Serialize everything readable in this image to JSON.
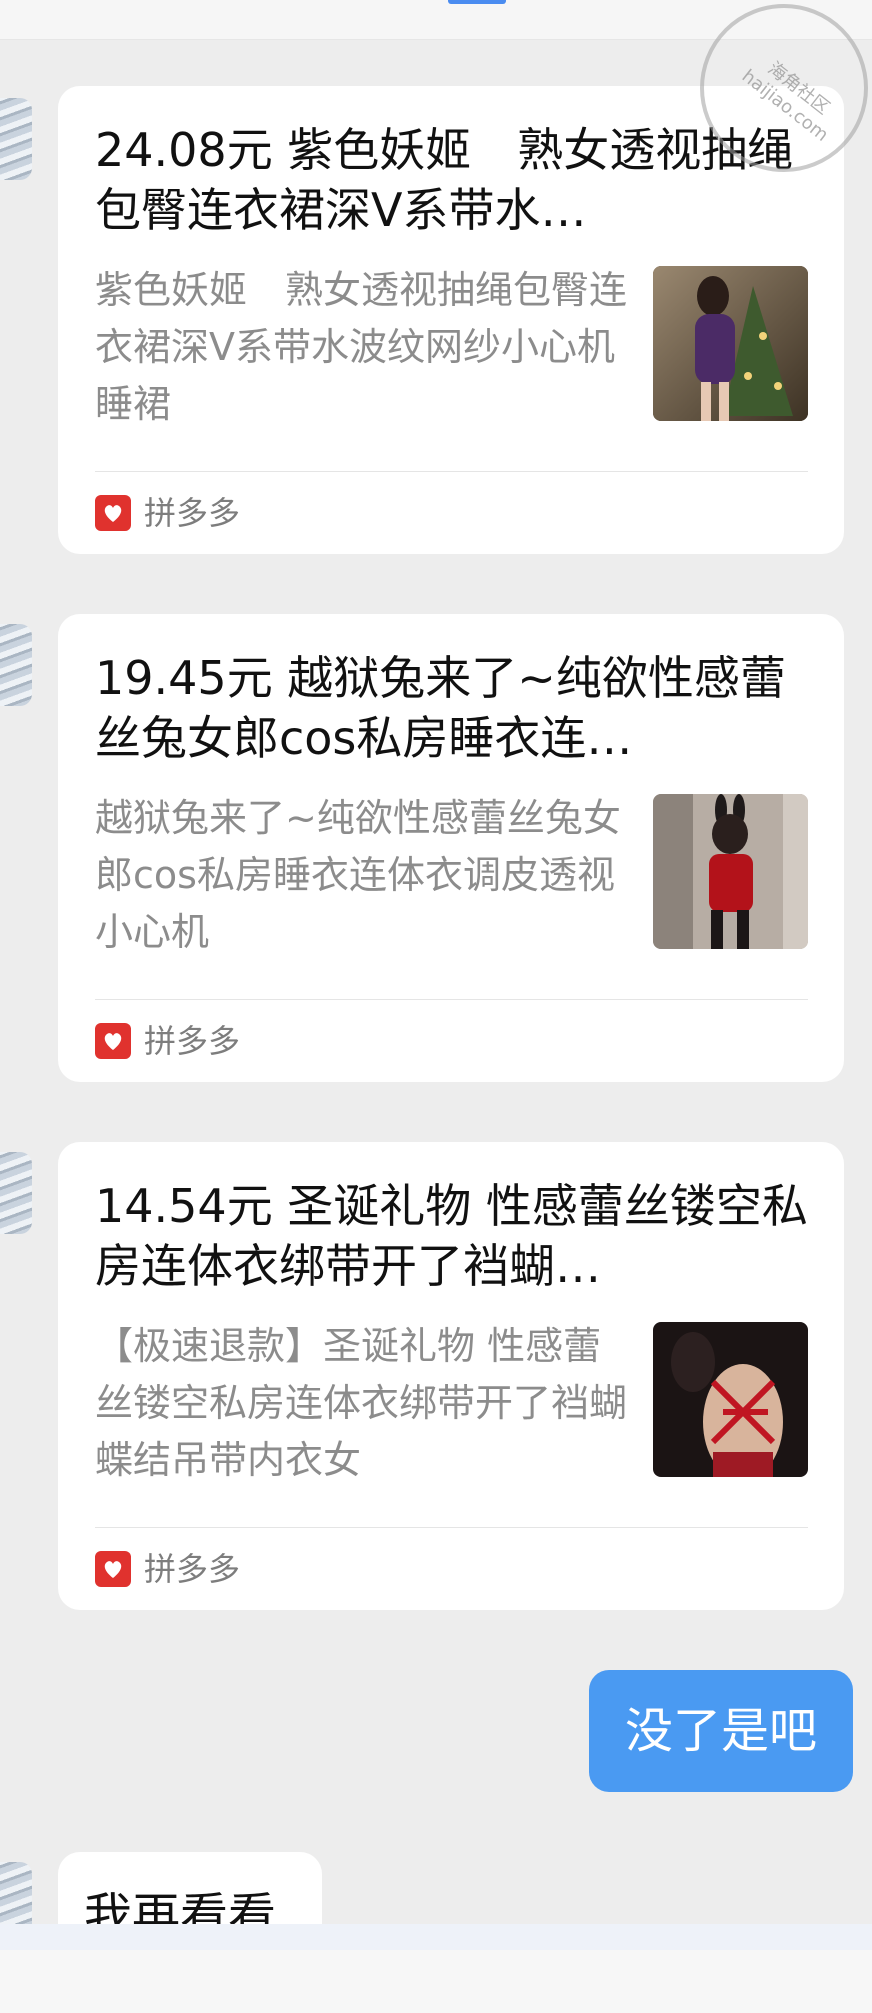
{
  "messages": [
    {
      "title": "24.08元 紫色妖姬　熟女透视抽绳包臀连衣裙深V系带水…",
      "description": "紫色妖姬　熟女透视抽绳包臀连衣裙深V系带水波纹网纱小心机睡裙",
      "source": "拼多多"
    },
    {
      "title": "19.45元 越狱兔来了~纯欲性感蕾丝兔女郎cos私房睡衣连…",
      "description": "越狱兔来了~纯欲性感蕾丝兔女郎cos私房睡衣连体衣调皮透视小心机",
      "source": "拼多多"
    },
    {
      "title": "14.54元 圣诞礼物 性感蕾丝镂空私房连体衣绑带开了裆蝴…",
      "description": "【极速退款】圣诞礼物 性感蕾丝镂空私房连体衣绑带开了裆蝴蝶结吊带内衣女",
      "source": "拼多多"
    }
  ],
  "my_reply": "没了是吧",
  "their_reply": "我再看看",
  "watermark": "海角社区 haijiao.com",
  "colors": {
    "my_bubble": "#4a9af2",
    "source_icon": "#e0322e",
    "background": "#ededed"
  }
}
